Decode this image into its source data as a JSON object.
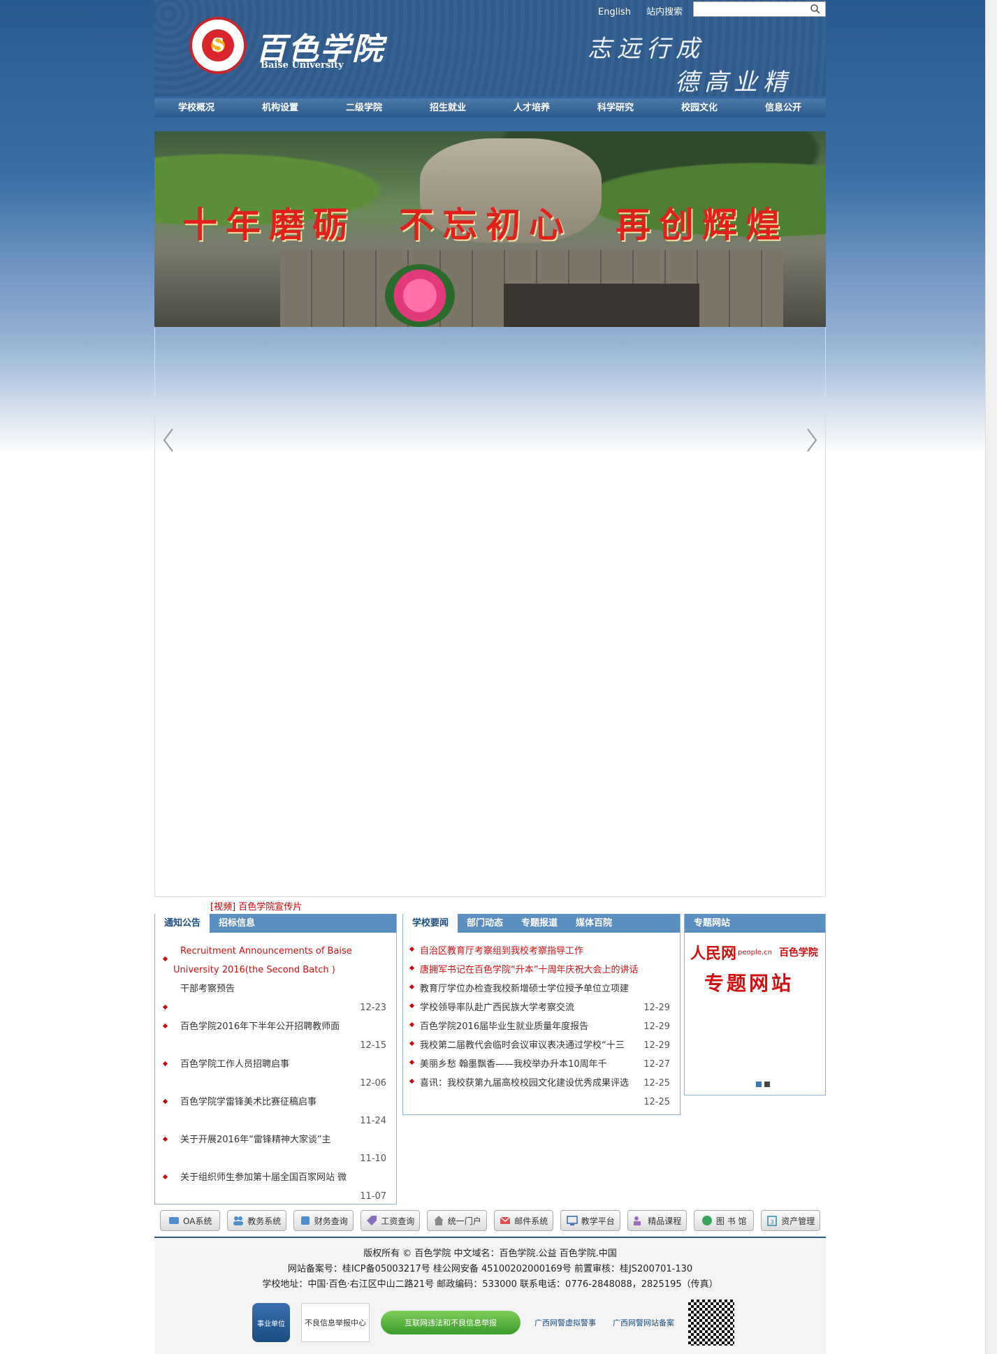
{
  "header": {
    "logo_cn": "百色学院",
    "logo_en": "Baise University",
    "motto_line1": "志远行成",
    "motto_line2": "德高业精",
    "english_link": "English",
    "search_label": "站内搜索",
    "search_placeholder": ""
  },
  "nav": [
    "学校概况",
    "机构设置",
    "二级学院",
    "招生就业",
    "人才培养",
    "科学研究",
    "校园文化",
    "信息公开"
  ],
  "banner": {
    "text": "十年磨砺　不忘初心　再创辉煌"
  },
  "caption": {
    "tag": "[视频]",
    "title": "百色学院宣传片"
  },
  "notice": {
    "tabs": [
      "通知公告",
      "招标信息"
    ],
    "items": [
      {
        "title": "Recruitment Announcements of Baise University 2016(the Second Batch )",
        "date": "",
        "red": true
      },
      {
        "title": "干部考察预告",
        "date": "12-23",
        "red": false
      },
      {
        "title": "百色学院2016年下半年公开招聘教师面",
        "date": "12-15",
        "red": false
      },
      {
        "title": "百色学院工作人员招聘启事",
        "date": "12-06",
        "red": false
      },
      {
        "title": "百色学院学雷锋美术比赛征稿启事",
        "date": "11-24",
        "red": false
      },
      {
        "title": "关于开展2016年“雷锋精神大家谈”主",
        "date": "11-10",
        "red": false
      },
      {
        "title": "关于组织师生参加第十届全国百家网站 微",
        "date": "11-07",
        "red": false
      }
    ]
  },
  "news": {
    "tabs": [
      "学校要闻",
      "部门动态",
      "专题报道",
      "媒体百院"
    ],
    "items": [
      {
        "title": "自治区教育厅考察组到我校考察指导工作",
        "red": true
      },
      {
        "title": "唐拥军书记在百色学院“升本”十周年庆祝大会上的讲话",
        "red": true
      },
      {
        "title": "教育厅学位办检查我校新增硕士学位授予单位立项建",
        "red": false
      },
      {
        "title": "学校领导率队赴广西民族大学考察交流",
        "red": false
      },
      {
        "title": "百色学院2016届毕业生就业质量年度报告",
        "red": false
      },
      {
        "title": "我校第二届教代会临时会议审议表决通过学校“十三",
        "red": false
      },
      {
        "title": "美丽乡愁 翰墨飘香——我校举办升本10周年千",
        "red": false
      },
      {
        "title": "喜讯：我校获第九届高校校园文化建设优秀成果评选",
        "red": false
      }
    ],
    "dates": [
      "12-29",
      "12-29",
      "12-29",
      "12-27",
      "12-25",
      "12-25"
    ]
  },
  "special": {
    "tab": "专题网站",
    "people_logo": "人民网",
    "people_domain": "people.cn",
    "school": "百色学院",
    "banner_text": "专题网站"
  },
  "systems": [
    "OA系统",
    "教务系统",
    "财务查询",
    "工资查询",
    "统一门户",
    "邮件系统",
    "教学平台",
    "精品课程",
    "图 书 馆",
    "资产管理"
  ],
  "footer": {
    "line1": "版权所有 © 百色学院 中文域名：百色学院.公益 百色学院.中国",
    "line2": "网站备案号：桂ICP备05003217号 桂公网安备 45100202000169号 前置审核：桂JS200701-130",
    "line3": "学校地址：中国·百色·右江区中山二路21号 邮政编码：533000 联系电话：0776-2848088，2825195（传真）",
    "logos": [
      "事业单位",
      "不良信息举报中心",
      "互联网违法和不良信息举报",
      "广西网警虚拟警事",
      "广西网警网站备案"
    ]
  },
  "colors": {
    "nav_bg": "#2c5a8c",
    "tab_active": "#1a4d80",
    "accent_red": "#d21010",
    "tab_bar": "#5a8ec0"
  }
}
